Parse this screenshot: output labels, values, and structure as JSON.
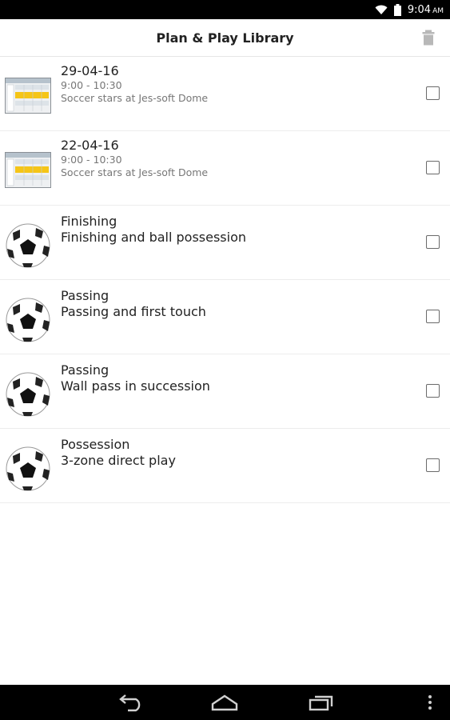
{
  "status": {
    "time": "9:04",
    "ampm": "AM",
    "icons": [
      "wifi-icon",
      "battery-icon"
    ]
  },
  "header": {
    "title": "Plan & Play Library",
    "action_icon": "trash-icon"
  },
  "items": [
    {
      "type": "schedule",
      "icon": "calendar-icon",
      "title": "29-04-16",
      "time": "9:00 - 10:30",
      "location": "Soccer stars at Jes-soft Dome",
      "checked": false
    },
    {
      "type": "schedule",
      "icon": "calendar-icon",
      "title": "22-04-16",
      "time": "9:00 - 10:30",
      "location": "Soccer stars at Jes-soft Dome",
      "checked": false
    },
    {
      "type": "drill",
      "icon": "soccer-ball-icon",
      "category": "Finishing",
      "name": "Finishing and ball possession",
      "checked": false
    },
    {
      "type": "drill",
      "icon": "soccer-ball-icon",
      "category": "Passing",
      "name": "Passing and first touch",
      "checked": false
    },
    {
      "type": "drill",
      "icon": "soccer-ball-icon",
      "category": "Passing",
      "name": "Wall pass in succession",
      "checked": false
    },
    {
      "type": "drill",
      "icon": "soccer-ball-icon",
      "category": "Possession",
      "name": "3-zone direct play",
      "checked": false
    }
  ],
  "navigation": {
    "icons": [
      "back-icon",
      "home-icon",
      "recent-apps-icon",
      "overflow-menu-icon"
    ]
  },
  "colors": {
    "status_bar": "#000000",
    "nav_bar": "#000000",
    "background": "#ffffff",
    "calendar_highlight": "#f5c518"
  }
}
